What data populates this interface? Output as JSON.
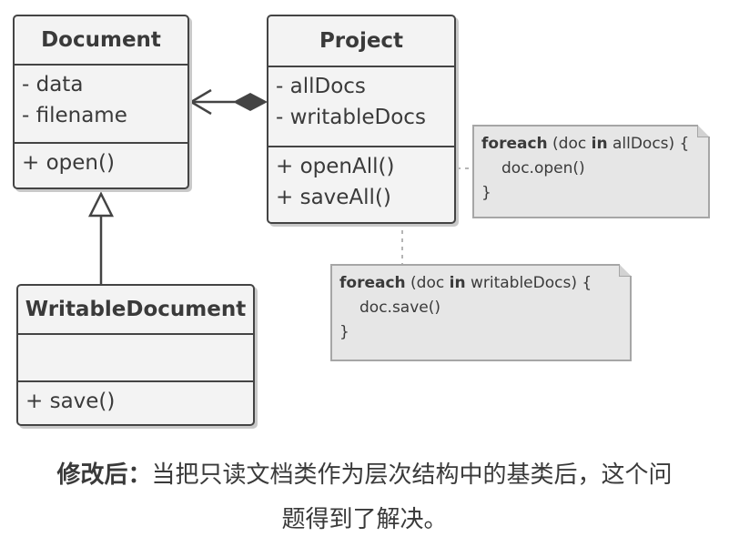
{
  "classes": {
    "document": {
      "name": "Document",
      "fields": [
        "- data",
        "- filename"
      ],
      "methods": [
        "+ open()"
      ]
    },
    "project": {
      "name": "Project",
      "fields": [
        "- allDocs",
        "- writableDocs"
      ],
      "methods": [
        "+ openAll()",
        "+ saveAll()"
      ]
    },
    "writable_document": {
      "name": "WritableDocument",
      "fields": [],
      "methods": [
        "+ save()"
      ]
    }
  },
  "notes": {
    "open_all": {
      "kw1": "foreach",
      "t1": " (doc ",
      "kw2": "in",
      "t2": " allDocs) {",
      "body": "doc.open()",
      "close": "}"
    },
    "save_all": {
      "kw1": "foreach",
      "t1": " (doc ",
      "kw2": "in",
      "t2": " writableDocs) {",
      "body": "doc.save()",
      "close": "}"
    }
  },
  "caption": {
    "label": "修改后：",
    "line1": "当把只读文档类作为层次结构中的基类后，这个问",
    "line2": "题得到了解决。"
  },
  "colors": {
    "border": "#444444",
    "fill": "#f3f3f3",
    "note_fill": "#e6e6e6",
    "dotted": "#b5b5b5"
  }
}
